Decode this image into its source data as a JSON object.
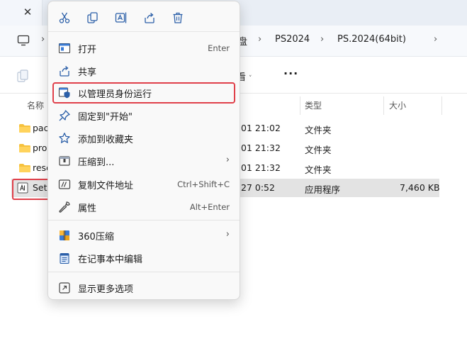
{
  "tab": {
    "close": "✕"
  },
  "address": {
    "segments": [
      "盘",
      "PS2024",
      "PS.2024(64bit)"
    ]
  },
  "toolbar": {
    "view": "看"
  },
  "columns": {
    "name": "名称",
    "type": "类型",
    "size": "大小"
  },
  "files": [
    {
      "name": "pac",
      "date": "01 21:02",
      "type": "文件夹",
      "size": ""
    },
    {
      "name": "pro",
      "date": "01 21:32",
      "type": "文件夹",
      "size": ""
    },
    {
      "name": "reso",
      "date": "01 21:32",
      "type": "文件夹",
      "size": ""
    },
    {
      "name": "Set",
      "date": "27 0:52",
      "type": "应用程序",
      "size": "7,460 KB"
    }
  ],
  "context_menu": {
    "quick_actions": [
      "cut-icon",
      "copy-icon",
      "rename-icon",
      "share-icon",
      "delete-icon"
    ],
    "items": [
      {
        "label": "打开",
        "shortcut": "Enter",
        "icon": "open-icon"
      },
      {
        "label": "共享",
        "shortcut": "",
        "icon": "share-icon"
      },
      {
        "label": "以管理员身份运行",
        "shortcut": "",
        "icon": "shield-icon"
      },
      {
        "label": "固定到\"开始\"",
        "shortcut": "",
        "icon": "pin-icon"
      },
      {
        "label": "添加到收藏夹",
        "shortcut": "",
        "icon": "star-icon"
      },
      {
        "label": "压缩到...",
        "shortcut": "",
        "icon": "zip-icon"
      },
      {
        "label": "复制文件地址",
        "shortcut": "Ctrl+Shift+C",
        "icon": "path-icon"
      },
      {
        "label": "属性",
        "shortcut": "Alt+Enter",
        "icon": "wrench-icon"
      },
      {
        "label": "360压缩",
        "shortcut": "",
        "icon": "archive-360-icon"
      },
      {
        "label": "在记事本中编辑",
        "shortcut": "",
        "icon": "notepad-icon"
      },
      {
        "label": "显示更多选项",
        "shortcut": "",
        "icon": "more-options-icon"
      }
    ],
    "submenu_arrow": "›"
  }
}
